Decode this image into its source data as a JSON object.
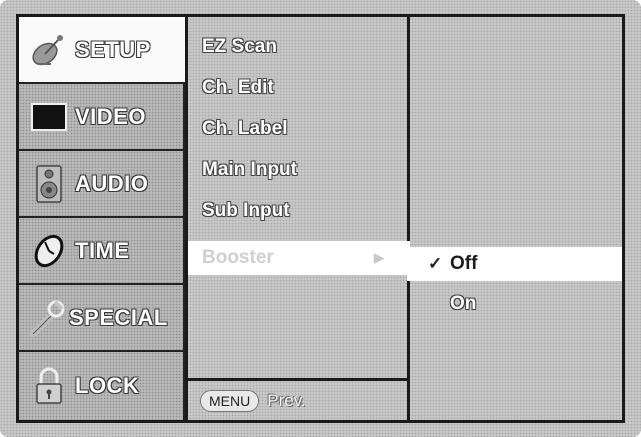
{
  "categories": [
    {
      "label": "SETUP",
      "icon": "satellite-dish-icon",
      "active": true
    },
    {
      "label": "VIDEO",
      "icon": "monitor-icon",
      "active": false
    },
    {
      "label": "AUDIO",
      "icon": "speaker-icon",
      "active": false
    },
    {
      "label": "TIME",
      "icon": "clock-icon",
      "active": false
    },
    {
      "label": "SPECIAL",
      "icon": "wrench-icon",
      "active": false
    },
    {
      "label": "LOCK",
      "icon": "padlock-icon",
      "active": false
    }
  ],
  "submenu": {
    "items": [
      {
        "label": "EZ Scan"
      },
      {
        "label": "Ch. Edit"
      },
      {
        "label": "Ch. Label"
      },
      {
        "label": "Main Input"
      },
      {
        "label": "Sub Input"
      },
      {
        "label": "Booster",
        "selected": true
      }
    ],
    "menu_button": "MENU",
    "prev_label": "Prev."
  },
  "options": {
    "items": [
      {
        "label": "Off",
        "checked": true
      },
      {
        "label": "On",
        "checked": false
      }
    ],
    "check_mark": "✓"
  },
  "colors": {
    "panel": "#c8c8c8",
    "active_tab": "#fafafa",
    "border": "#1a1a1a"
  }
}
